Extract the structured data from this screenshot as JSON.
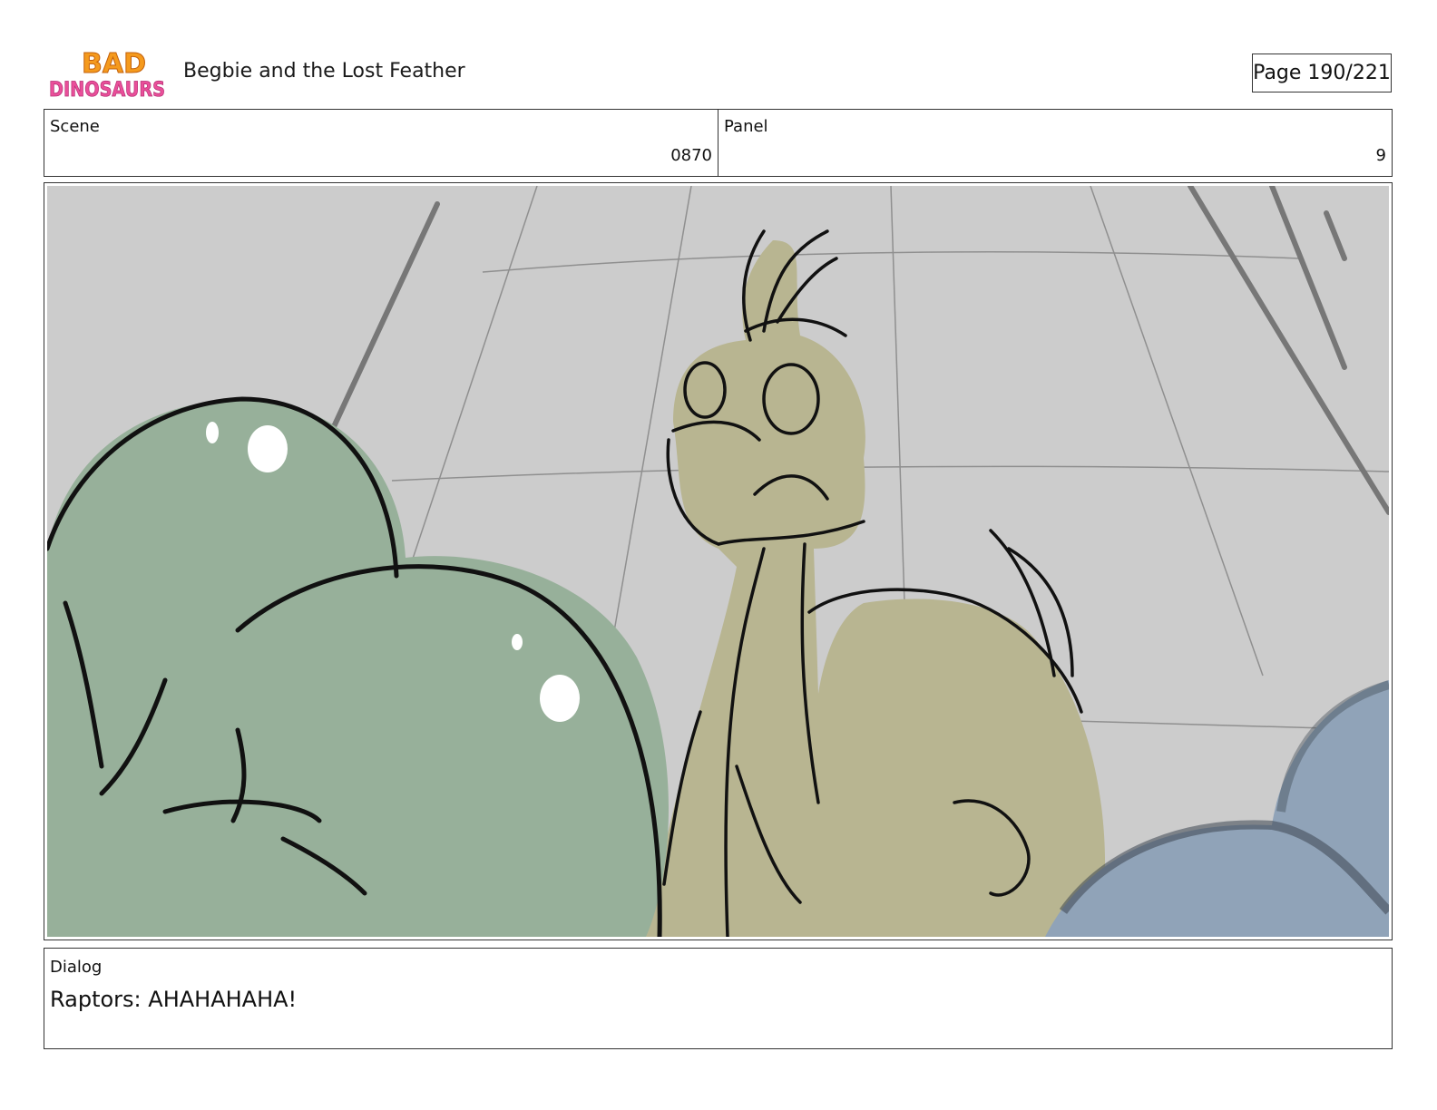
{
  "header": {
    "logo_line1": "BAD",
    "logo_line2": "DINOSAURS",
    "title": "Begbie and the Lost Feather",
    "page": "Page 190/221"
  },
  "info": {
    "scene_label": "Scene",
    "scene_value": "0870",
    "panel_label": "Panel",
    "panel_value": "9"
  },
  "dialog": {
    "label": "Dialog",
    "text": "Raptors: AHAHAHAHA!"
  },
  "colors": {
    "background_gray": "#cccccc",
    "green_dino": "#97b09a",
    "tan_dino": "#b8b591",
    "blue_dino": "#90a3b8"
  }
}
